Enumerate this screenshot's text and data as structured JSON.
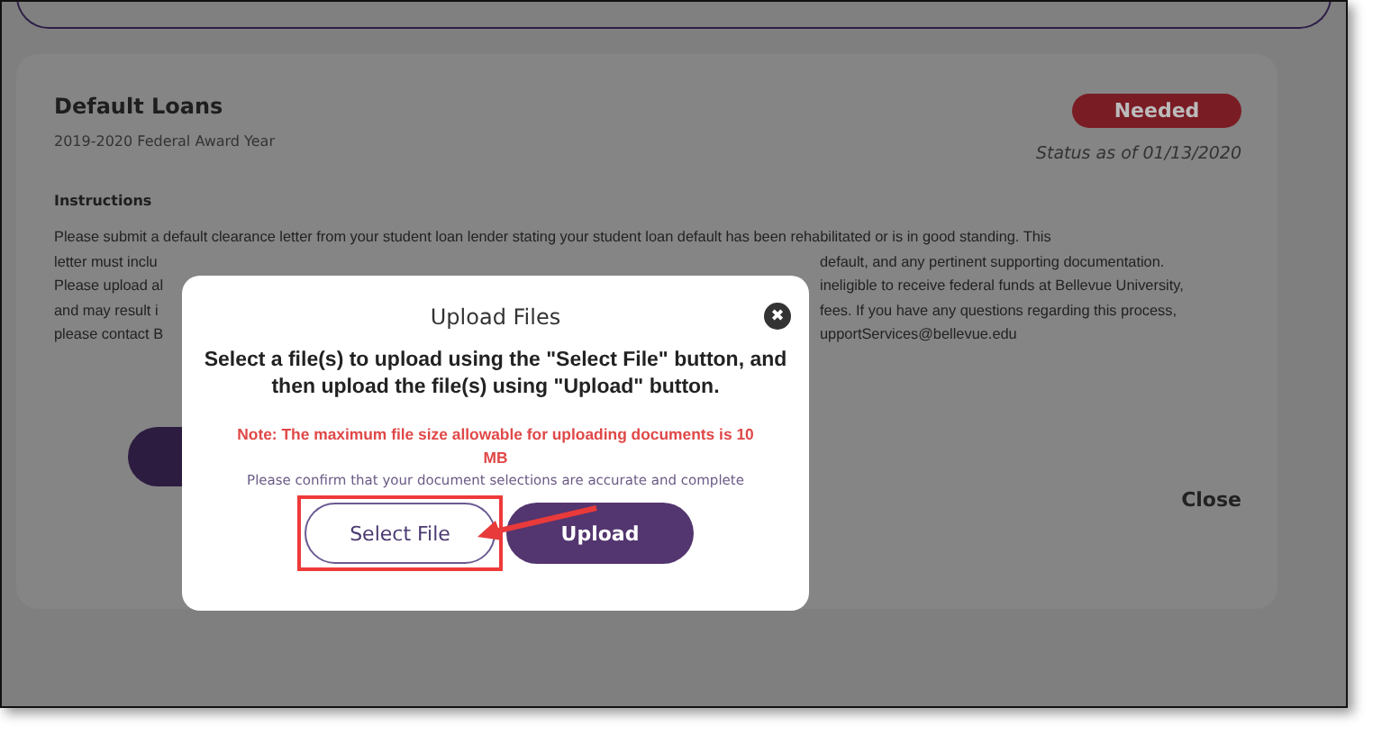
{
  "card": {
    "title": "Default Loans",
    "subtitle": "2019-2020 Federal Award Year",
    "status": {
      "label": "Needed",
      "color": "#7a1c24"
    },
    "status_date": "Status as of 01/13/2020",
    "instructions_heading": "Instructions",
    "instructions_first_line": "Please submit a default clearance letter from your student loan lender stating your student loan default has been rehabilitated or is in good standing. This",
    "instructions_lines": [
      {
        "left": "letter must inclu",
        "right": "default, and any pertinent supporting documentation."
      },
      {
        "left": "Please upload al",
        "right": "ineligible to receive federal funds at Bellevue University,"
      },
      {
        "left": "and may result i",
        "right": "fees. If you have any questions regarding this process,"
      },
      {
        "left": "please contact B",
        "right": "upportServices@bellevue.edu"
      }
    ],
    "close_label": "Close"
  },
  "dialog": {
    "title": "Upload Files",
    "close_icon": "✖",
    "message": "Select a file(s) to upload using the \"Select File\" button, and then upload the file(s) using \"Upload\" button.",
    "note": "Note: The maximum file size allowable for uploading documents is 10 MB",
    "confirm": "Please confirm that your document selections are accurate and complete",
    "buttons": [
      {
        "label": "Select File",
        "kind": "outline",
        "highlighted": true
      },
      {
        "label": "Upload",
        "kind": "primary",
        "highlighted": false
      }
    ]
  }
}
